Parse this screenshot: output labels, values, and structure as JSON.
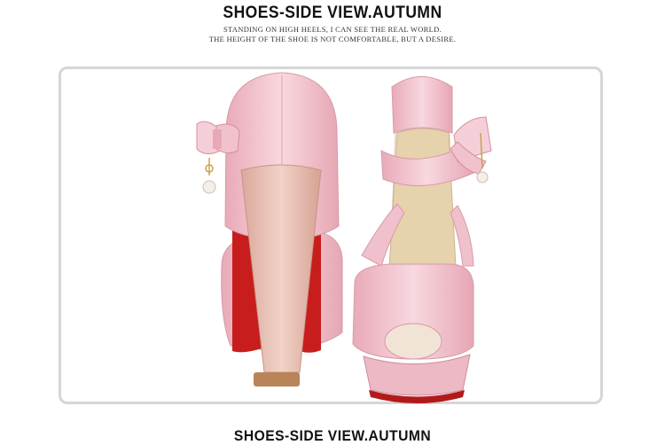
{
  "header": {
    "title": "SHOES-SIDE VIEW.AUTUMN",
    "subtitle_line1": "STANDING ON HIGH HEELS, I CAN SEE THE REAL WORLD.",
    "subtitle_line2": "THE HEIGHT OF THE SHOE IS NOT COMFORTABLE, BUT A DESIRE."
  },
  "footer": {
    "title": "SHOES-SIDE VIEW.AUTUMN"
  },
  "colors": {
    "shoe_pink": "#f3c6cf",
    "shoe_shadow": "#d99aa8",
    "sole_red": "#cc1f1f",
    "heel_tan": "#e9c4b8",
    "insole": "#e8d7b4",
    "frame": "#d6d6d6"
  }
}
